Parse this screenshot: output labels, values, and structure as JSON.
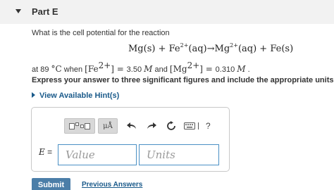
{
  "part": {
    "title": "Part E"
  },
  "question": {
    "prompt": "What is the cell potential for the reaction",
    "reaction": {
      "lhs1": "Mg(s) + Fe",
      "lhs1_charge": "2+",
      "lhs2": "(aq)→Mg",
      "rhs_charge": "2+",
      "rhs": "(aq) + Fe(s)"
    },
    "conditions": {
      "at": "at 89",
      "deg": "°C",
      "when": " when ",
      "fe_open": "[Fe",
      "fe_charge": "2+",
      "fe_close": "] = ",
      "fe_value": "3.50",
      "fe_unit": "M",
      "and": " and ",
      "mg_open": "[Mg",
      "mg_charge": "2+",
      "mg_close": "] = ",
      "mg_value": "0.310",
      "mg_unit": "M",
      "period": " ."
    },
    "instruction": "Express your answer to three significant figures and include the appropriate units."
  },
  "hints": {
    "label": "View Available Hint(s)"
  },
  "answer": {
    "variable": "E",
    "equals": " =",
    "value_placeholder": "Value",
    "units_placeholder": "Units",
    "toolbar": {
      "mu_label": "μÅ",
      "help_label": "?"
    }
  },
  "actions": {
    "submit_label": "Submit",
    "previous_label": "Previous Answers"
  }
}
